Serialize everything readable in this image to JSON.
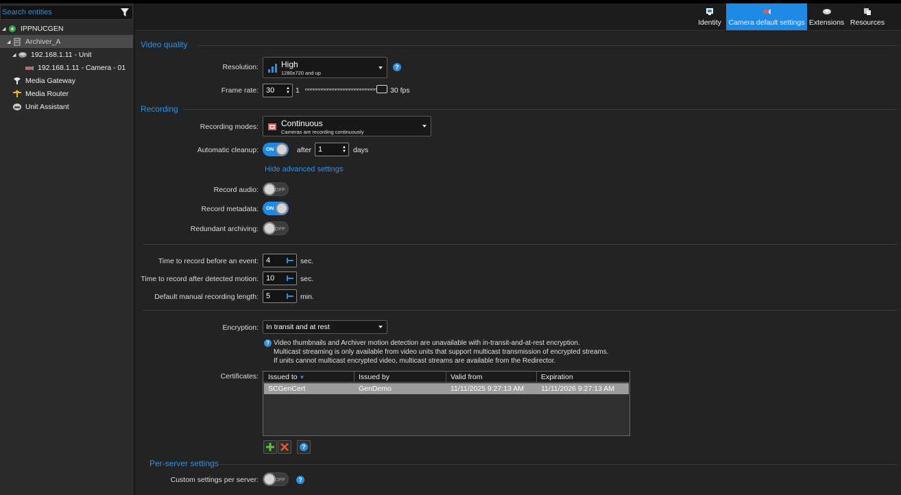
{
  "sidebar": {
    "search_placeholder": "Search entities",
    "tree": [
      {
        "label": "IPPNUCGEN"
      },
      {
        "label": "Archiver_A"
      },
      {
        "label": "192.168.1.11 - Unit"
      },
      {
        "label": "192.168.1.11 - Camera - 01"
      },
      {
        "label": "Media Gateway"
      },
      {
        "label": "Media Router"
      },
      {
        "label": "Unit Assistant"
      }
    ]
  },
  "toolbar": {
    "tabs": [
      {
        "label": "Identity",
        "icon": "identity-icon"
      },
      {
        "label": "Camera default settings",
        "icon": "camera-settings-icon"
      },
      {
        "label": "Extensions",
        "icon": "extensions-icon"
      },
      {
        "label": "Resources",
        "icon": "resources-icon"
      }
    ],
    "active_tab": "Camera default settings"
  },
  "video_quality": {
    "title": "Video quality",
    "resolution_label": "Resolution:",
    "resolution_value": "High",
    "resolution_sub": "1280x720 and up",
    "framerate_label": "Frame rate:",
    "framerate_value": "30",
    "framerate_min": "1",
    "framerate_max": "30 fps"
  },
  "recording": {
    "title": "Recording",
    "modes_label": "Recording modes:",
    "modes_value": "Continuous",
    "modes_sub": "Cameras are recording continuously",
    "cleanup_label": "Automatic cleanup:",
    "cleanup_state": "ON",
    "cleanup_after": "after",
    "cleanup_value": "1",
    "cleanup_unit": "days",
    "advanced_link": "Hide advanced settings",
    "audio_label": "Record audio:",
    "audio_state": "OFF",
    "metadata_label": "Record metadata:",
    "metadata_state": "ON",
    "redundant_label": "Redundant archiving:",
    "redundant_state": "OFF"
  },
  "timing": {
    "before_label": "Time to record before an event:",
    "before_value": "4",
    "before_unit": "sec.",
    "after_label": "Time to record after detected motion:",
    "after_value": "10",
    "after_unit": "sec.",
    "manual_label": "Default manual recording length:",
    "manual_value": "5",
    "manual_unit": "min."
  },
  "encryption": {
    "label": "Encryption:",
    "value": "In transit and at rest",
    "info_lines": [
      "Video thumbnails and Archiver motion detection are unavailable with in-transit-and-at-rest encryption.",
      "Multicast streaming is only available from video units that support multicast transmission of encrypted streams.",
      "If units cannot multicast encrypted video, multicast streams are available from the Redirector."
    ],
    "certificates_label": "Certificates:",
    "columns": [
      "Issued to",
      "Issued by",
      "Valid from",
      "Expiration"
    ],
    "rows": [
      [
        "SCGenCert",
        "GenDemo",
        "11/11/2025 9:27:13 AM",
        "11/11/2026 9:27:13 AM"
      ]
    ]
  },
  "per_server": {
    "title": "Per-server settings",
    "custom_label": "Custom settings per server:",
    "custom_state": "OFF"
  },
  "colors": {
    "accent": "#1f8ae6",
    "background": "#232323",
    "sidebar": "#2b2b2b"
  }
}
